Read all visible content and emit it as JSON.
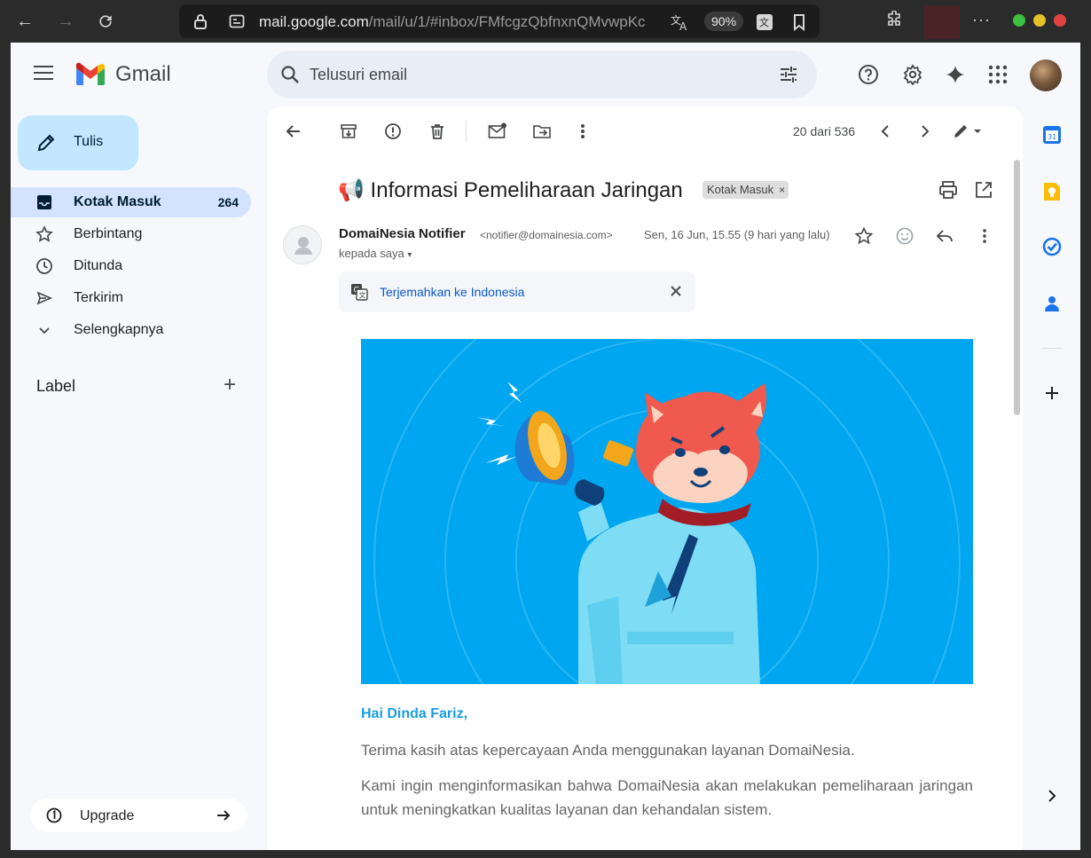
{
  "browser": {
    "url_host": "mail.google.com",
    "url_path": "/mail/u/1/#inbox/FMfcgzQbfnxnQMvwpKc",
    "zoom": "90%"
  },
  "app": {
    "logo_text": "Gmail"
  },
  "search": {
    "placeholder": "Telusuri email"
  },
  "sidebar": {
    "compose_label": "Tulis",
    "items": [
      {
        "label": "Kotak Masuk",
        "count": "264",
        "icon": "inbox-icon"
      },
      {
        "label": "Berbintang",
        "icon": "star-icon"
      },
      {
        "label": "Ditunda",
        "icon": "clock-icon"
      },
      {
        "label": "Terkirim",
        "icon": "send-icon"
      },
      {
        "label": "Selengkapnya",
        "icon": "chevron-down-icon"
      }
    ],
    "label_heading": "Label",
    "upgrade_label": "Upgrade"
  },
  "toolbar": {
    "pager": "20 dari 536"
  },
  "message": {
    "subject": "📢 Informasi Pemeliharaan Jaringan",
    "badge": "Kotak Masuk",
    "badge_close": "×",
    "sender_name": "DomaiNesia Notifier",
    "sender_email": "<notifier@domainesia.com>",
    "date": "Sen, 16 Jun, 15.55 (9 hari yang lalu)",
    "to": "kepada saya",
    "translate_link": "Terjemahkan ke Indonesia",
    "greeting": "Hai Dinda Fariz,",
    "paragraphs": [
      "Terima kasih atas kepercayaan Anda menggunakan layanan DomaiNesia.",
      "Kami ingin menginformasikan bahwa DomaiNesia akan melakukan pemeliharaan jaringan untuk meningkatkan kualitas layanan dan kehandalan sistem."
    ]
  },
  "colors": {
    "compose_bg": "#c2e7ff",
    "active_nav_bg": "#d3e3fd",
    "hero_bg": "#00a6ef",
    "greeting": "#1a9ee0",
    "link": "#0b57d0"
  }
}
